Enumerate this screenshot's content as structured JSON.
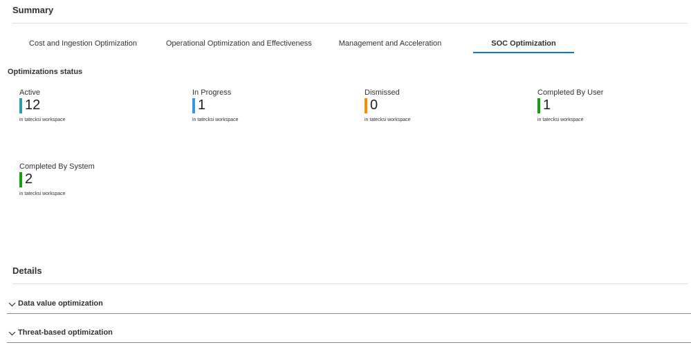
{
  "summary": {
    "title": "Summary"
  },
  "tabs": [
    {
      "label": "Cost and Ingestion Optimization",
      "active": false
    },
    {
      "label": "Operational Optimization and Effectiveness",
      "active": false
    },
    {
      "label": "Management and Acceleration",
      "active": false
    },
    {
      "label": "SOC Optimization",
      "active": true
    }
  ],
  "status": {
    "title": "Optimizations status",
    "tiles": [
      {
        "label": "Active",
        "value": "12",
        "caption": "in tatecksi workspace",
        "color": "#2aa0a4"
      },
      {
        "label": "In Progress",
        "value": "1",
        "caption": "in tatecksi workspace",
        "color": "#3a96dd"
      },
      {
        "label": "Dismissed",
        "value": "0",
        "caption": "in tatecksi workspace",
        "color": "#ff8c00"
      },
      {
        "label": "Completed By User",
        "value": "1",
        "caption": "in tatecksi workspace",
        "color": "#13a10e"
      },
      {
        "label": "Completed By System",
        "value": "2",
        "caption": "in tatecksi workspace",
        "color": "#13a10e"
      }
    ]
  },
  "details": {
    "title": "Details",
    "sections": [
      {
        "label": "Data value optimization",
        "icon": "chevron-down-icon"
      },
      {
        "label": "Threat-based optimization",
        "icon": "chevron-down-icon"
      }
    ]
  },
  "colors": {
    "accent": "#0078d4",
    "divider": "#e1dfdd"
  }
}
